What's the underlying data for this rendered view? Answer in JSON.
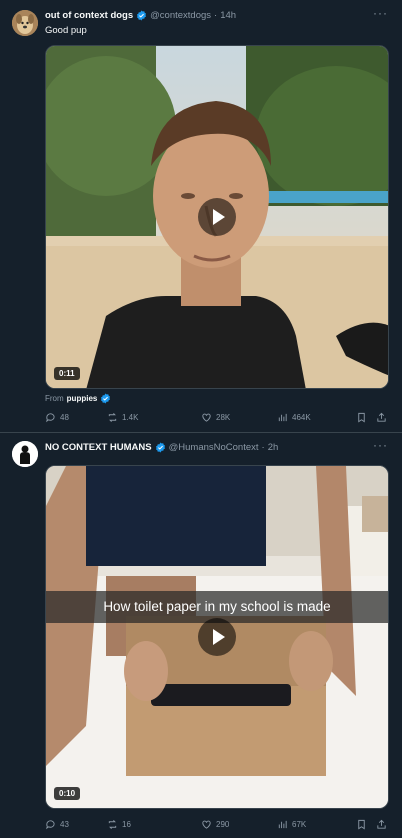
{
  "colors": {
    "background": "#15202b",
    "verified": "#1d9bf0",
    "muted": "#8b98a5",
    "text": "#f7f9f9"
  },
  "tweets": [
    {
      "author": {
        "name": "out of context dogs",
        "handle": "@contextdogs",
        "time": "14h",
        "verified": true
      },
      "text": "Good pup",
      "media": {
        "type": "video",
        "duration": "0:11"
      },
      "source": {
        "prefix": "From",
        "account": "puppies"
      },
      "stats": {
        "replies": "48",
        "reposts": "1.4K",
        "likes": "28K",
        "views": "464K"
      }
    },
    {
      "author": {
        "name": "NO CONTEXT HUMANS",
        "handle": "@HumansNoContext",
        "time": "2h",
        "verified": true
      },
      "media": {
        "type": "video",
        "duration": "0:10",
        "caption": "How toilet paper in my school is made"
      },
      "stats": {
        "replies": "43",
        "reposts": "16",
        "likes": "290",
        "views": "67K"
      }
    }
  ],
  "icons": {
    "more": "more-dots-icon",
    "reply": "reply-icon",
    "repost": "repost-icon",
    "like": "heart-icon",
    "views": "views-icon",
    "bookmark": "bookmark-icon",
    "share": "share-icon",
    "verified": "verified-badge-icon",
    "play": "play-icon"
  }
}
